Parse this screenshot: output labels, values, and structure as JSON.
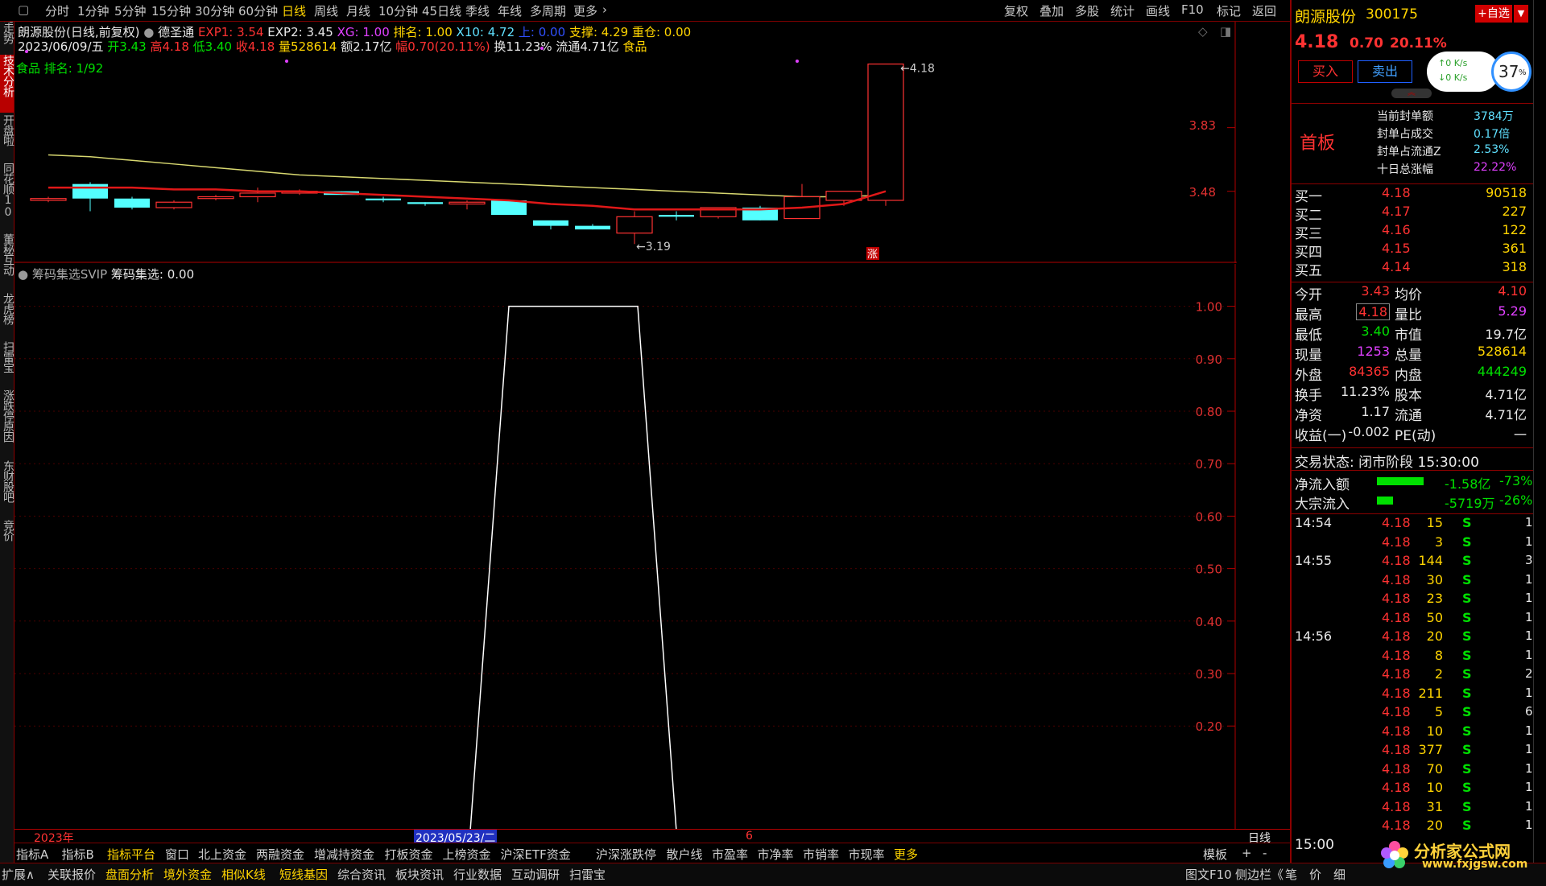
{
  "toolbar": {
    "periods": [
      "分时",
      "1分钟",
      "5分钟",
      "15分钟",
      "30分钟",
      "60分钟",
      "日线",
      "周线",
      "月线",
      "10分钟",
      "45日线",
      "季线",
      "年线",
      "多周期",
      "更多"
    ],
    "active_period": "日线",
    "right_items": [
      "复权",
      "叠加",
      "多股",
      "统计",
      "画线",
      "F10",
      "标记",
      "返回"
    ]
  },
  "left_tabs": [
    "分时走势",
    "技术分析",
    "开盘啦",
    "同花顺10",
    "董秘互动",
    "龙虎榜",
    "扫雷宝",
    "涨跌停原因",
    "东财股吧",
    "竞价"
  ],
  "price_header": {
    "stock": "朗源股份(日线,前复权)",
    "indicator": "德圣通",
    "exp1": "EXP1: 3.54",
    "exp2": "EXP2: 3.45",
    "xg": "XG: 1.00",
    "rank": "排名: 1.00",
    "x10": "X10: 4.72",
    "up": "上: 0.00",
    "support": "支撑: 4.29",
    "position": "重仓: 0.00",
    "line2_date": "2023/06/09/五",
    "open": "开3.43",
    "high": "高4.18",
    "low": "低3.40",
    "close": "收4.18",
    "vol": "量528614",
    "amount": "额2.17亿",
    "change": "幅0.70(20.11%)",
    "turnover": "换11.23%",
    "float": "流通4.71亿",
    "sector": "食品",
    "sector_rank": "食品 排名: 1/92"
  },
  "price_axis": [
    "3.83",
    "3.48"
  ],
  "price_marks": {
    "high_label": "4.18",
    "low_label": "3.19",
    "limit_badge": "涨"
  },
  "indicator_header": {
    "name": "筹码集选SVIP",
    "value_label": "筹码集选: 0.00"
  },
  "ind_axis": [
    "1.00",
    "0.90",
    "0.80",
    "0.70",
    "0.60",
    "0.50",
    "0.40",
    "0.30",
    "0.20"
  ],
  "date_axis": {
    "year": "2023年",
    "cursor_date": "2023/05/23/二",
    "month": "6",
    "period": "日线"
  },
  "chart_data": {
    "type": "candlestick",
    "candles": [
      {
        "o": 3.43,
        "c": 3.44,
        "h": 3.45,
        "l": 3.42
      },
      {
        "o": 3.52,
        "c": 3.44,
        "h": 3.53,
        "l": 3.37
      },
      {
        "o": 3.44,
        "c": 3.39,
        "h": 3.45,
        "l": 3.38
      },
      {
        "o": 3.39,
        "c": 3.42,
        "h": 3.43,
        "l": 3.38
      },
      {
        "o": 3.44,
        "c": 3.45,
        "h": 3.46,
        "l": 3.43
      },
      {
        "o": 3.45,
        "c": 3.47,
        "h": 3.5,
        "l": 3.42
      },
      {
        "o": 3.47,
        "c": 3.48,
        "h": 3.49,
        "l": 3.46
      },
      {
        "o": 3.48,
        "c": 3.46,
        "h": 3.48,
        "l": 3.46
      },
      {
        "o": 3.44,
        "c": 3.43,
        "h": 3.45,
        "l": 3.42
      },
      {
        "o": 3.42,
        "c": 3.41,
        "h": 3.42,
        "l": 3.4
      },
      {
        "o": 3.41,
        "c": 3.42,
        "h": 3.43,
        "l": 3.38
      },
      {
        "o": 3.43,
        "c": 3.35,
        "h": 3.43,
        "l": 3.35
      },
      {
        "o": 3.32,
        "c": 3.29,
        "h": 3.32,
        "l": 3.27
      },
      {
        "o": 3.29,
        "c": 3.27,
        "h": 3.3,
        "l": 3.27
      },
      {
        "o": 3.25,
        "c": 3.34,
        "h": 3.37,
        "l": 3.19
      },
      {
        "o": 3.35,
        "c": 3.34,
        "h": 3.37,
        "l": 3.32
      },
      {
        "o": 3.34,
        "c": 3.39,
        "h": 3.39,
        "l": 3.33
      },
      {
        "o": 3.39,
        "c": 3.32,
        "h": 3.4,
        "l": 3.32
      },
      {
        "o": 3.33,
        "c": 3.45,
        "h": 3.52,
        "l": 3.33
      },
      {
        "o": 3.43,
        "c": 3.48,
        "h": 3.48,
        "l": 3.4
      },
      {
        "o": 3.43,
        "c": 4.18,
        "h": 4.18,
        "l": 3.4
      }
    ],
    "ma_red": [
      3.5,
      3.5,
      3.5,
      3.49,
      3.49,
      3.48,
      3.48,
      3.47,
      3.46,
      3.45,
      3.44,
      3.43,
      3.41,
      3.4,
      3.38,
      3.38,
      3.38,
      3.38,
      3.39,
      3.41,
      3.48
    ],
    "ma_yellow": [
      3.68,
      3.67,
      3.65,
      3.63,
      3.61,
      3.59,
      3.57,
      3.56,
      3.55,
      3.54,
      3.53,
      3.52,
      3.51,
      3.5,
      3.49,
      3.48,
      3.47,
      3.46,
      3.45,
      3.45,
      3.46
    ],
    "price_range": [
      3.12,
      4.28
    ],
    "indicator": {
      "name": "筹码集选",
      "x": [
        0,
        1,
        2,
        3,
        4,
        5,
        6,
        7,
        8,
        9,
        10,
        11,
        12,
        13,
        14,
        15,
        16,
        17,
        18,
        19,
        20
      ],
      "values": [
        0,
        0,
        0,
        0,
        0,
        0,
        0,
        0,
        0,
        0,
        0,
        1,
        1,
        1,
        1,
        0,
        0,
        0,
        0,
        0,
        0
      ],
      "ylim": [
        0.05,
        1.05
      ]
    }
  },
  "quote": {
    "name": "朗源股份",
    "code": "300175",
    "add_btn": "+自选",
    "price": "4.18",
    "change": "0.70",
    "pct": "20.11%",
    "buy_btn": "买入",
    "sell_btn": "卖出",
    "speed_up": "↑0 K/s",
    "speed_down": "↓0 K/s",
    "gauge": "37",
    "gauge_unit": "%",
    "first_board": "首板",
    "seal_info": [
      {
        "label": "当前封单额",
        "value": "3784万"
      },
      {
        "label": "封单占成交",
        "value": "0.17倍"
      },
      {
        "label": "封单占流通Z",
        "value": "2.53%"
      },
      {
        "label": "十日总涨幅",
        "value": "22.22%"
      }
    ],
    "bids": [
      {
        "label": "买一",
        "price": "4.18",
        "vol": "90518"
      },
      {
        "label": "买二",
        "price": "4.17",
        "vol": "227"
      },
      {
        "label": "买三",
        "price": "4.16",
        "vol": "122"
      },
      {
        "label": "买四",
        "price": "4.15",
        "vol": "361"
      },
      {
        "label": "买五",
        "price": "4.14",
        "vol": "318"
      }
    ],
    "stats": [
      {
        "l1": "今开",
        "v1": "3.43",
        "l2": "均价",
        "v2": "4.10"
      },
      {
        "l1": "最高",
        "v1": "4.18",
        "l2": "量比",
        "v2": "5.29"
      },
      {
        "l1": "最低",
        "v1": "3.40",
        "l2": "市值",
        "v2": "19.7亿"
      },
      {
        "l1": "现量",
        "v1": "1253",
        "l2": "总量",
        "v2": "528614"
      },
      {
        "l1": "外盘",
        "v1": "84365",
        "l2": "内盘",
        "v2": "444249"
      },
      {
        "l1": "换手",
        "v1": "11.23%",
        "l2": "股本",
        "v2": "4.71亿"
      },
      {
        "l1": "净资",
        "v1": "1.17",
        "l2": "流通",
        "v2": "4.71亿"
      },
      {
        "l1": "收益(一)",
        "v1": "-0.002",
        "l2": "PE(动)",
        "v2": "一"
      }
    ],
    "trade_status": "交易状态: 闭市阶段 15:30:00",
    "net_inflow_label": "净流入额",
    "net_inflow": "-1.58亿",
    "net_inflow_pct": "-73%",
    "block_label": "大宗流入",
    "block": "-5719万",
    "block_pct": "-26%",
    "ticks": [
      {
        "t": "14:54",
        "p": "4.18",
        "v": "15",
        "s": "S",
        "n": "1"
      },
      {
        "t": "",
        "p": "4.18",
        "v": "3",
        "s": "S",
        "n": "1"
      },
      {
        "t": "14:55",
        "p": "4.18",
        "v": "144",
        "s": "S",
        "n": "3"
      },
      {
        "t": "",
        "p": "4.18",
        "v": "30",
        "s": "S",
        "n": "1"
      },
      {
        "t": "",
        "p": "4.18",
        "v": "23",
        "s": "S",
        "n": "1"
      },
      {
        "t": "",
        "p": "4.18",
        "v": "50",
        "s": "S",
        "n": "1"
      },
      {
        "t": "14:56",
        "p": "4.18",
        "v": "20",
        "s": "S",
        "n": "1"
      },
      {
        "t": "",
        "p": "4.18",
        "v": "8",
        "s": "S",
        "n": "1"
      },
      {
        "t": "",
        "p": "4.18",
        "v": "2",
        "s": "S",
        "n": "2"
      },
      {
        "t": "",
        "p": "4.18",
        "v": "211",
        "s": "S",
        "n": "1"
      },
      {
        "t": "",
        "p": "4.18",
        "v": "5",
        "s": "S",
        "n": "6"
      },
      {
        "t": "",
        "p": "4.18",
        "v": "10",
        "s": "S",
        "n": "1"
      },
      {
        "t": "",
        "p": "4.18",
        "v": "377",
        "s": "S",
        "n": "1"
      },
      {
        "t": "",
        "p": "4.18",
        "v": "70",
        "s": "S",
        "n": "1"
      },
      {
        "t": "",
        "p": "4.18",
        "v": "10",
        "s": "S",
        "n": "1"
      },
      {
        "t": "",
        "p": "4.18",
        "v": "31",
        "s": "S",
        "n": "1"
      },
      {
        "t": "",
        "p": "4.18",
        "v": "20",
        "s": "S",
        "n": "1"
      }
    ],
    "close_time": "15:00"
  },
  "bottom_tabs1": [
    "指标A",
    "指标B",
    "指标平台",
    "窗口",
    "北上资金",
    "两融资金",
    "增减持资金",
    "打板资金",
    "上榜资金",
    "沪深ETF资金",
    "沪深涨跌停",
    "散户线",
    "市盈率",
    "市净率",
    "市销率",
    "市现率",
    "更多"
  ],
  "bottom_tabs1_right": [
    "模板",
    "+",
    "-"
  ],
  "bottom_tabs2": [
    "扩展∧",
    "关联报价",
    "盘面分析",
    "境外资金",
    "相似K线",
    "短线基因",
    "综合资讯",
    "板块资讯",
    "行业数据",
    "互动调研",
    "扫雷宝"
  ],
  "bottom_tabs2_right": [
    "图文F10",
    "侧边栏《",
    "笔",
    "价",
    "细"
  ],
  "watermark": {
    "title": "分析家公式网",
    "url": "www.fxjgsw.com"
  }
}
